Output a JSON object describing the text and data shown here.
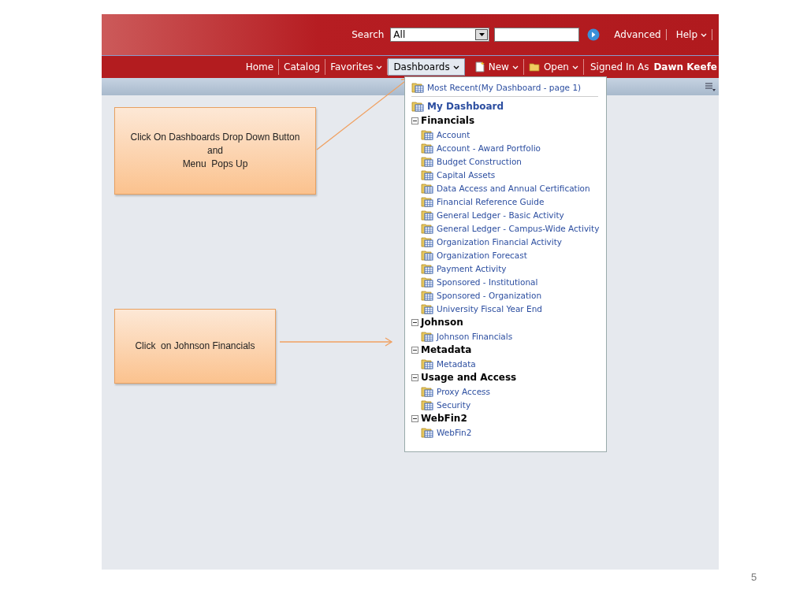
{
  "header": {
    "search_label": "Search",
    "search_scope": "All",
    "links": [
      "Advanced",
      "Help"
    ]
  },
  "nav": {
    "items": [
      {
        "label": "Home",
        "kind": "link",
        "selected": false
      },
      {
        "label": "Catalog",
        "kind": "link",
        "selected": false
      },
      {
        "label": "Favorites",
        "kind": "menu",
        "selected": false
      },
      {
        "label": "Dashboards",
        "kind": "menu",
        "selected": true
      },
      {
        "label": "New",
        "kind": "new-menu",
        "selected": false
      },
      {
        "label": "Open",
        "kind": "open-menu",
        "selected": false
      }
    ],
    "signed_in_label": "Signed In As",
    "user": "Dawn Keefe"
  },
  "menu": {
    "recent": "Most Recent(My Dashboard - page 1)",
    "my_dashboard": "My Dashboard",
    "groups": [
      {
        "title": "Financials",
        "expanded": true,
        "children": [
          "Account",
          "Account - Award Portfolio",
          "Budget Construction",
          "Capital Assets",
          "Data Access and Annual Certification",
          "Financial Reference Guide",
          "General Ledger - Basic Activity",
          "General Ledger - Campus-Wide Activity",
          "Organization Financial Activity",
          "Organization Forecast",
          "Payment Activity",
          "Sponsored - Institutional",
          "Sponsored - Organization",
          "University Fiscal Year End"
        ]
      },
      {
        "title": "Johnson",
        "expanded": true,
        "children": [
          "Johnson Financials"
        ]
      },
      {
        "title": "Metadata",
        "expanded": true,
        "children": [
          "Metadata"
        ]
      },
      {
        "title": "Usage and Access",
        "expanded": true,
        "children": [
          "Proxy Access",
          "Security"
        ]
      },
      {
        "title": "WebFin2",
        "expanded": true,
        "children": [
          "WebFin2"
        ]
      }
    ]
  },
  "callouts": [
    {
      "text": "Click On Dashboards Drop Down Button\nand\nMenu  Pops Up"
    },
    {
      "text": "Click  on Johnson Financials"
    }
  ],
  "slide_number": "5"
}
